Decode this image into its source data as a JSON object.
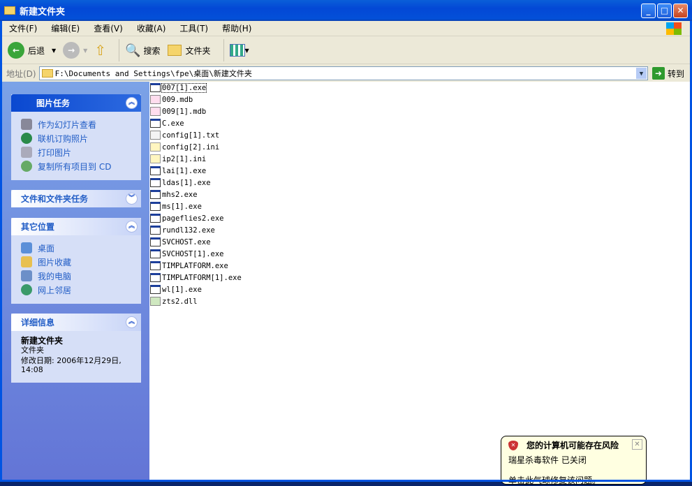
{
  "window": {
    "title": "新建文件夹"
  },
  "menu": [
    "文件(F)",
    "编辑(E)",
    "查看(V)",
    "收藏(A)",
    "工具(T)",
    "帮助(H)"
  ],
  "toolbar": {
    "back": "后退",
    "search": "搜索",
    "folders": "文件夹"
  },
  "address": {
    "label": "地址(D)",
    "path": "F:\\Documents and Settings\\fpe\\桌面\\新建文件夹",
    "go": "转到"
  },
  "panels": {
    "picture_tasks": {
      "title": "图片任务",
      "items": [
        "作为幻灯片查看",
        "联机订购照片",
        "打印图片",
        "复制所有项目到 CD"
      ]
    },
    "file_tasks": {
      "title": "文件和文件夹任务"
    },
    "other_places": {
      "title": "其它位置",
      "items": [
        "桌面",
        "图片收藏",
        "我的电脑",
        "网上邻居"
      ]
    },
    "details": {
      "title": "详细信息",
      "name": "新建文件夹",
      "type": "文件夹",
      "modified": "修改日期: 2006年12月29日, 14:08"
    }
  },
  "files": [
    {
      "name": "007[1].exe",
      "type": "exe"
    },
    {
      "name": "009.mdb",
      "type": "mdb"
    },
    {
      "name": "009[1].mdb",
      "type": "mdb"
    },
    {
      "name": "C.exe",
      "type": "exe"
    },
    {
      "name": "config[1].txt",
      "type": "txt"
    },
    {
      "name": "config[2].ini",
      "type": "ini"
    },
    {
      "name": "ip2[1].ini",
      "type": "ini"
    },
    {
      "name": "lai[1].exe",
      "type": "exe"
    },
    {
      "name": "ldas[1].exe",
      "type": "exe"
    },
    {
      "name": "mhs2.exe",
      "type": "exe"
    },
    {
      "name": "ms[1].exe",
      "type": "exe"
    },
    {
      "name": "pageflies2.exe",
      "type": "exe"
    },
    {
      "name": "rundl132.exe",
      "type": "exe"
    },
    {
      "name": "SVCHOST.exe",
      "type": "exe"
    },
    {
      "name": "SVCHOST[1].exe",
      "type": "exe"
    },
    {
      "name": "TIMPLATFORM.exe",
      "type": "exe"
    },
    {
      "name": "TIMPLATFORM[1].exe",
      "type": "exe"
    },
    {
      "name": "wl[1].exe",
      "type": "exe"
    },
    {
      "name": "zts2.dll",
      "type": "dll"
    }
  ],
  "balloon": {
    "title": "您的计算机可能存在风险",
    "line1": "瑞星杀毒软件  已关闭",
    "line2": "单击此气球修复该问题。"
  }
}
